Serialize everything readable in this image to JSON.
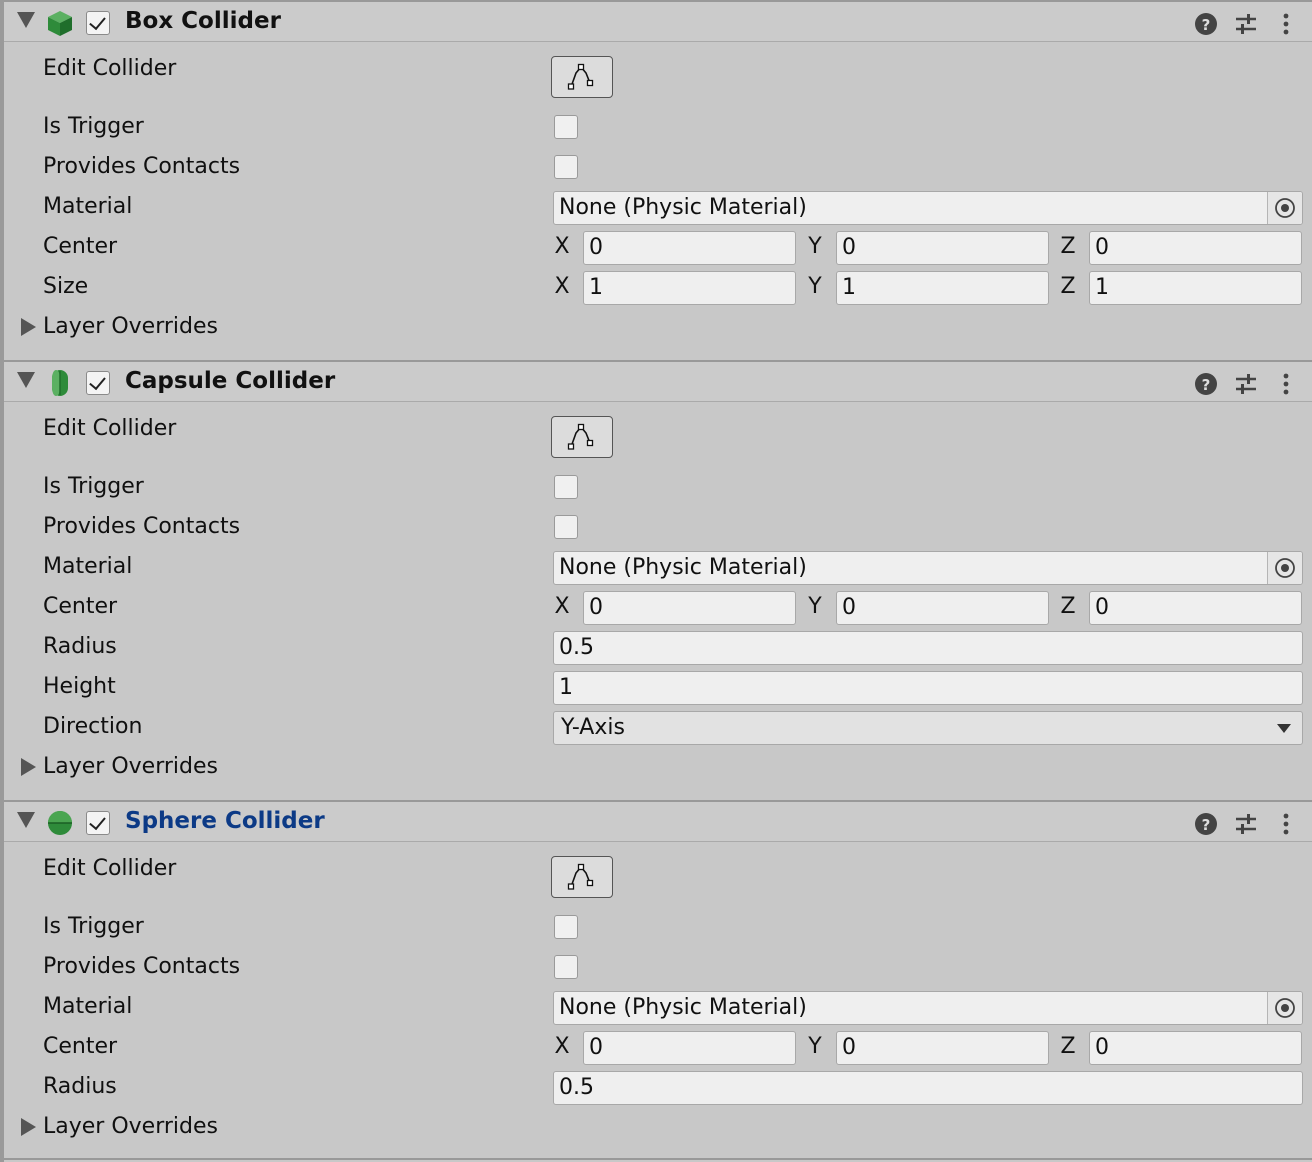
{
  "components": [
    {
      "title": "Box Collider",
      "rows": {
        "edit_collider": "Edit Collider",
        "is_trigger": "Is Trigger",
        "provides_contacts": "Provides Contacts",
        "material": "Material",
        "material_value": "None (Physic Material)",
        "center": "Center",
        "center_x": "0",
        "center_y": "0",
        "center_z": "0",
        "size": "Size",
        "size_x": "1",
        "size_y": "1",
        "size_z": "1",
        "layer_overrides": "Layer Overrides"
      }
    },
    {
      "title": "Capsule Collider",
      "rows": {
        "edit_collider": "Edit Collider",
        "is_trigger": "Is Trigger",
        "provides_contacts": "Provides Contacts",
        "material": "Material",
        "material_value": "None (Physic Material)",
        "center": "Center",
        "center_x": "0",
        "center_y": "0",
        "center_z": "0",
        "radius": "Radius",
        "radius_value": "0.5",
        "height": "Height",
        "height_value": "1",
        "direction": "Direction",
        "direction_value": "Y-Axis",
        "layer_overrides": "Layer Overrides"
      }
    },
    {
      "title": "Sphere Collider",
      "rows": {
        "edit_collider": "Edit Collider",
        "is_trigger": "Is Trigger",
        "provides_contacts": "Provides Contacts",
        "material": "Material",
        "material_value": "None (Physic Material)",
        "center": "Center",
        "center_x": "0",
        "center_y": "0",
        "center_z": "0",
        "radius": "Radius",
        "radius_value": "0.5",
        "layer_overrides": "Layer Overrides"
      }
    }
  ],
  "axis_labels": {
    "x": "X",
    "y": "Y",
    "z": "Z"
  },
  "icons": {
    "box": "box-collider-icon",
    "capsule": "capsule-collider-icon",
    "sphere": "sphere-collider-icon",
    "help": "help-icon",
    "presets": "presets-icon",
    "menu": "kebab-menu-icon",
    "edit": "edit-collider-icon",
    "picker": "object-picker-icon"
  },
  "colors": {
    "icon_green": "#2e8b3a",
    "sphere_title": "#0c3a86"
  }
}
